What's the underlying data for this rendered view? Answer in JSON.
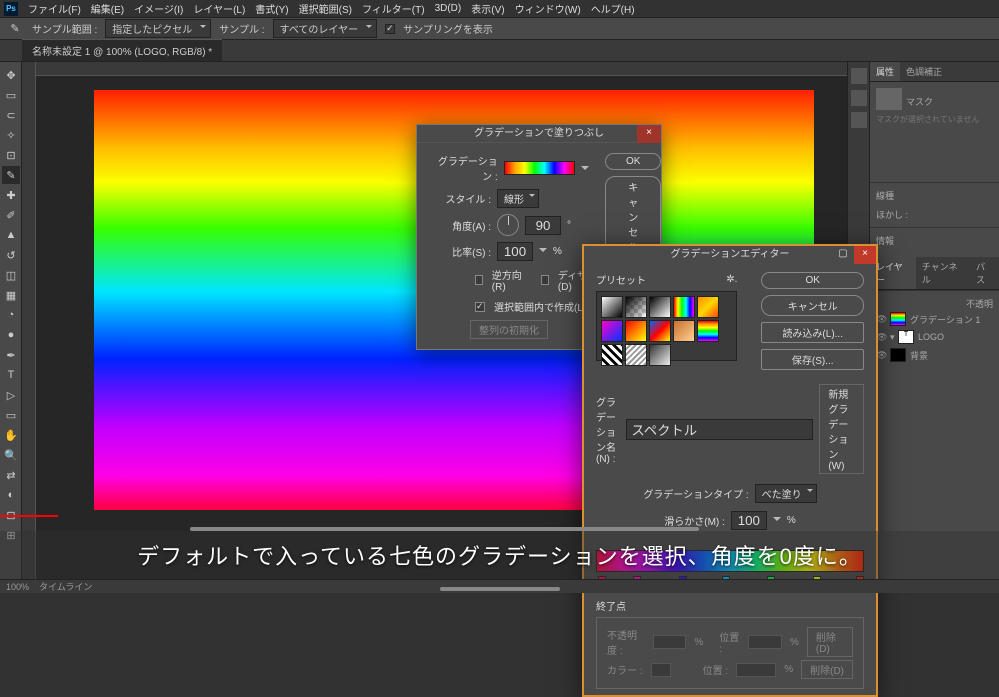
{
  "menu": {
    "items": [
      "ファイル(F)",
      "編集(E)",
      "イメージ(I)",
      "レイヤー(L)",
      "書式(Y)",
      "選択範囲(S)",
      "フィルター(T)",
      "3D(D)",
      "表示(V)",
      "ウィンドウ(W)",
      "ヘルプ(H)"
    ],
    "ps": "Ps"
  },
  "options": {
    "sample_area_label": "サンプル範囲 :",
    "sample_area_value": "指定したピクセル",
    "sample_label": "サンプル :",
    "sample_value": "すべてのレイヤー",
    "show_sampling": "サンプリングを表示"
  },
  "tab": {
    "title": "名称未設定 1 @ 100% (LOGO, RGB/8) *"
  },
  "tools": [
    "↕",
    "▭",
    "▱",
    "✥",
    "✂",
    "✎",
    "↺",
    "✐",
    "⌫",
    "⟳",
    "◔",
    "●",
    "▲",
    "T",
    "▷",
    "◻",
    "✋",
    "🔍",
    "◐",
    "⊡",
    "⊞"
  ],
  "dock_icons": [
    "◧",
    "⊞",
    "≡",
    "A",
    "¶",
    "⋯",
    "◐",
    "⊡"
  ],
  "panels": {
    "props_tabs": [
      "属性",
      "色調補正"
    ],
    "mask_label": "マスク",
    "mask_hint": "マスクが選択されていません",
    "char_label": "線種",
    "para_label": "ほかし :",
    "info_label": "情報",
    "layers_tabs": [
      "レイヤー",
      "チャンネル",
      "パス"
    ],
    "layer_opacity_label": "不透明",
    "layer_items": [
      "グラデーション 1",
      "LOGO",
      "背景"
    ]
  },
  "fill_dialog": {
    "title": "グラデーションで塗りつぶし",
    "grad_label": "グラデーション :",
    "style_label": "スタイル :",
    "style_value": "線形",
    "angle_label": "角度(A) :",
    "angle_value": "90",
    "scale_label": "比率(S) :",
    "scale_value": "100",
    "scale_unit": "%",
    "reverse": "逆方向(R)",
    "dither": "ディザ(D)",
    "align": "選択範囲内で作成(L)",
    "reset": "整列の初期化",
    "ok": "OK",
    "cancel": "キャンセル"
  },
  "editor_dialog": {
    "title": "グラデーションエディター",
    "preset_label": "プリセット",
    "ok": "OK",
    "cancel": "キャンセル",
    "load": "読み込み(L)...",
    "save": "保存(S)...",
    "name_label": "グラデーション名(N) :",
    "name_value": "スペクトル",
    "new_btn": "新規グラデーション (W)",
    "type_label": "グラデーションタイプ :",
    "type_value": "べた塗り",
    "smooth_label": "滑らかさ(M) :",
    "smooth_value": "100",
    "smooth_unit": "%",
    "endpoint_label": "終了点",
    "opacity_label": "不透明度 :",
    "pos_label": "位置 :",
    "del_label": "削除(D)",
    "color_label": "カラー :",
    "pct": "%"
  },
  "caption": "デフォルトで入っている七色のグラデーションを選択、角度を0度に。",
  "status": {
    "zoom": "100%",
    "timeline": "タイムライン"
  }
}
